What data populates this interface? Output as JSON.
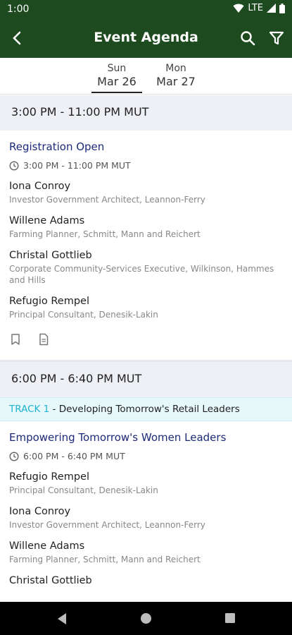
{
  "status": {
    "time": "1:00",
    "network": "LTE"
  },
  "appbar": {
    "title": "Event Agenda"
  },
  "date_tabs": [
    {
      "dow": "Sun",
      "date": "Mar 26",
      "selected": true
    },
    {
      "dow": "Mon",
      "date": "Mar 27",
      "selected": false
    }
  ],
  "slots": [
    {
      "header": "3:00 PM - 11:00 PM MUT",
      "session": {
        "title": "Registration Open",
        "time": "3:00 PM - 11:00 PM MUT",
        "speakers": [
          {
            "name": "Iona Conroy",
            "role": "Investor Government Architect, Leannon-Ferry"
          },
          {
            "name": "Willene Adams",
            "role": "Farming Planner, Schmitt, Mann and Reichert"
          },
          {
            "name": "Christal Gottlieb",
            "role": "Corporate Community-Services Executive, Wilkinson, Hammes and Hills"
          },
          {
            "name": "Refugio Rempel",
            "role": "Principal Consultant, Denesik-Lakin"
          }
        ]
      }
    },
    {
      "header": "6:00 PM - 6:40 PM MUT",
      "track": {
        "label": "TRACK 1",
        "text": " - Developing Tomorrow's Retail Leaders"
      },
      "session": {
        "title": "Empowering Tomorrow's Women Leaders",
        "time": "6:00 PM - 6:40 PM MUT",
        "speakers": [
          {
            "name": "Refugio Rempel",
            "role": "Principal Consultant, Denesik-Lakin"
          },
          {
            "name": "Iona Conroy",
            "role": "Investor Government Architect, Leannon-Ferry"
          },
          {
            "name": "Willene Adams",
            "role": "Farming Planner, Schmitt, Mann and Reichert"
          },
          {
            "name": "Christal Gottlieb",
            "role": ""
          }
        ]
      }
    }
  ],
  "colors": {
    "appbar": "#1d4a1f",
    "session_title": "#1c2a7a",
    "track_label": "#20b3cf",
    "slot_header_bg": "#eef0f6"
  }
}
